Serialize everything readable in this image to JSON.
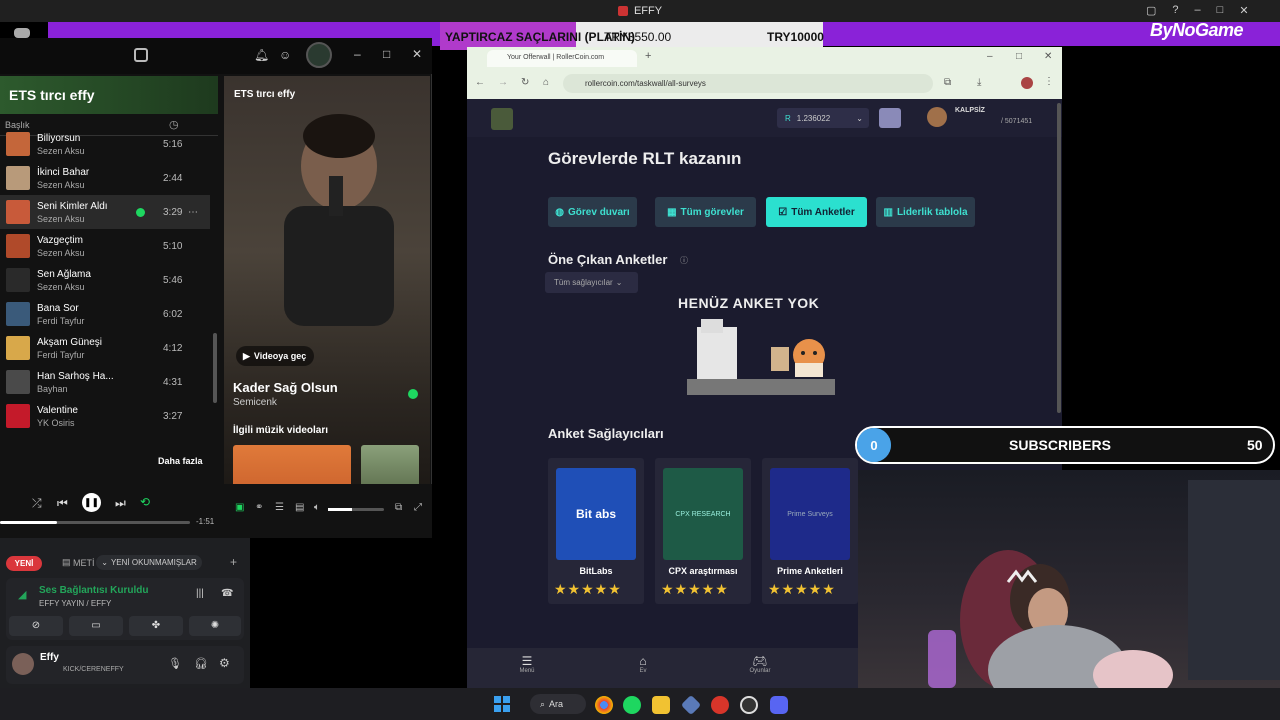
{
  "topbar": {
    "title": "EFFY"
  },
  "goal": {
    "label": "YAPTIRCAZ SAÇLARINI (PLATİN)",
    "current": "TRY3550.00",
    "target": "TRY10000",
    "progress": 0.355
  },
  "brand": {
    "logo_text": "ByNoGame"
  },
  "spotify": {
    "playlist_title": "ETS tırcı effy",
    "column_header": "Başlık",
    "songs": [
      {
        "title": "Biliyorsun",
        "artist": "Sezen Aksu",
        "duration": "5:16"
      },
      {
        "title": "İkinci Bahar",
        "artist": "Sezen Aksu",
        "duration": "2:44"
      },
      {
        "title": "Seni Kimler Aldı",
        "artist": "Sezen Aksu",
        "duration": "3:29"
      },
      {
        "title": "Vazgeçtim",
        "artist": "Sezen Aksu",
        "duration": "5:10"
      },
      {
        "title": "Sen Ağlama",
        "artist": "Sezen Aksu",
        "duration": "5:46"
      },
      {
        "title": "Bana Sor",
        "artist": "Ferdi Tayfur",
        "duration": "6:02"
      },
      {
        "title": "Akşam Güneşi",
        "artist": "Ferdi Tayfur",
        "duration": "4:12"
      },
      {
        "title": "Han Sarhoş Ha...",
        "artist": "Bayhan",
        "duration": "4:31"
      },
      {
        "title": "Valentine",
        "artist": "YK Osiris",
        "duration": "3:27"
      }
    ],
    "now_playing_panel_title": "ETS tırcı effy",
    "video_button": "Videoya geç",
    "now_title": "Kader Sağ Olsun",
    "now_artist": "Semicenk",
    "related_header": "İlgili müzik videoları",
    "more_label": "Daha fazla",
    "time_remaining": "-1:51",
    "playback_progress": 0.3
  },
  "discord": {
    "new_badge": "YENİ",
    "channel_label": "METİ",
    "unread_label": "YENİ OKUNMAMIŞLAR",
    "voice_status": "Ses Bağlantısı Kuruldu",
    "voice_channel": "EFFY YAYIN / EFFY",
    "username": "Effy",
    "user_status": "KICK/CERENEFFY"
  },
  "browser": {
    "tab_title": "Your Offerwall | RollerCoin.com",
    "url": "rollercoin.com/taskwall/all-surveys",
    "balance": "1.236022",
    "user_name": "KALPSİZ",
    "user_stats": "/ 5071451",
    "page_title": "Görevlerde RLT kazanın",
    "tabs": [
      "Görev duvarı",
      "Tüm görevler",
      "Tüm Anketler",
      "Liderlik tablola"
    ],
    "featured_title": "Öne Çıkan Anketler",
    "provider_filter": "Tüm sağlayıcılar",
    "empty_text": "HENÜZ ANKET YOK",
    "providers_title": "Anket Sağlayıcıları",
    "providers": [
      {
        "name": "BitLabs",
        "logo": "Bit abs"
      },
      {
        "name": "CPX araştırması",
        "logo": "CPX RESEARCH"
      },
      {
        "name": "Prime Anketleri",
        "logo": "Prime Surveys"
      }
    ],
    "bottom_nav": [
      "Menü",
      "Ev",
      "Oyunlar"
    ]
  },
  "subscribers": {
    "label": "SUBSCRIBERS",
    "current": "0",
    "goal": "50",
    "progress": 0.0
  },
  "taskbar": {
    "search": "Ara"
  }
}
